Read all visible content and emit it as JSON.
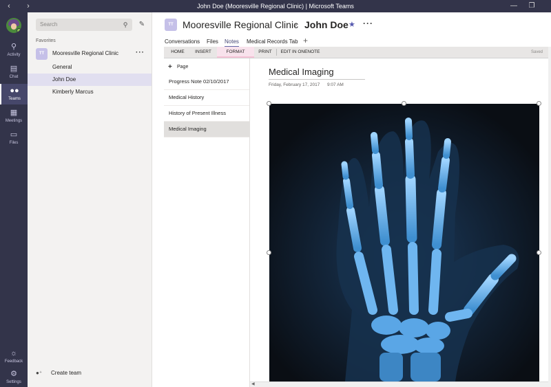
{
  "window": {
    "title": "John Doe (Mooresville Regional Clinic) | Microsoft Teams",
    "back_icon": "chevron-left-icon",
    "forward_icon": "chevron-right-icon"
  },
  "rail": {
    "items": [
      {
        "label": "Activity",
        "icon": "bell-icon"
      },
      {
        "label": "Chat",
        "icon": "chat-icon"
      },
      {
        "label": "Teams",
        "icon": "teams-icon"
      },
      {
        "label": "Meetings",
        "icon": "calendar-icon"
      },
      {
        "label": "Files",
        "icon": "file-icon"
      },
      {
        "label": "Feedback",
        "icon": "lightbulb-icon"
      },
      {
        "label": "Settings",
        "icon": "gear-icon"
      }
    ],
    "active": "Teams"
  },
  "sidebar": {
    "search_placeholder": "Search",
    "favorites_label": "Favorites",
    "team": {
      "initials": "TT",
      "name": "Mooresville Regional Clinic"
    },
    "channels": [
      "General",
      "John Doe",
      "Kimberly Marcus"
    ],
    "active_channel": "John Doe",
    "create_team": "Create team"
  },
  "header": {
    "team_initials": "TT",
    "team_name": "Mooresville Regional Clinic",
    "channel_name": "John Doe",
    "tabs": [
      "Conversations",
      "Files",
      "Notes",
      "Medical Records Tab"
    ],
    "active_tab": "Notes",
    "add_tab": "+"
  },
  "ribbon": {
    "tabs": [
      "HOME",
      "INSERT",
      "FORMAT",
      "PRINT",
      "EDIT IN ONENOTE"
    ],
    "active_tab": "FORMAT",
    "status": "Saved"
  },
  "pages": {
    "add_label": "Page",
    "items": [
      "Progress Note 02/10/2017",
      "Medical History",
      "History of Present Illness",
      "Medical Imaging"
    ],
    "active": "Medical Imaging"
  },
  "note": {
    "title": "Medical Imaging",
    "date": "Friday, February 17, 2017",
    "time": "9:07 AM",
    "image": "hand-xray-image"
  },
  "colors": {
    "rail_bg": "#33344a",
    "accent": "#6264a7",
    "format_tab": "#f8e2ec",
    "xray_bone": "#7fc4ff"
  }
}
